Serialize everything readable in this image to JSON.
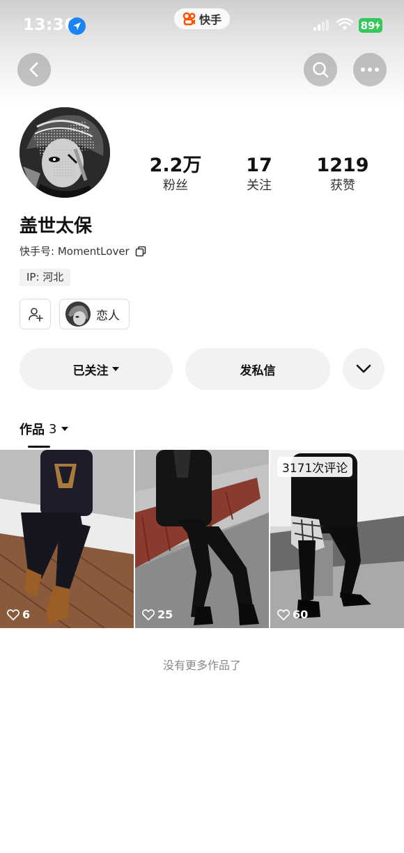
{
  "status_bar": {
    "time": "13:36",
    "battery": "89"
  },
  "app_badge": {
    "name": "快手"
  },
  "nav": {
    "back_icon": "chevron-left-icon",
    "search_icon": "search-icon",
    "more_icon": "more-dots-icon"
  },
  "profile": {
    "nickname": "盖世太保",
    "kwai_id": "快手号: MomentLover",
    "ip": "IP: 河北",
    "stats": [
      {
        "value": "2.2万",
        "label": "粉丝"
      },
      {
        "value": "17",
        "label": "关注"
      },
      {
        "value": "1219",
        "label": "获赞"
      }
    ],
    "relation_label": "恋人"
  },
  "actions": {
    "follow_label": "已关注",
    "message_label": "发私信"
  },
  "works": {
    "tab_label": "作品",
    "count": "3",
    "items": [
      {
        "likes": "6",
        "badge": ""
      },
      {
        "likes": "25",
        "badge": ""
      },
      {
        "likes": "60",
        "badge": "3171次评论"
      }
    ],
    "footer": "没有更多作品了"
  },
  "colors": {
    "accent_orange": "#ff5000",
    "battery_green": "#34c759",
    "location_blue": "#1b84f5"
  }
}
